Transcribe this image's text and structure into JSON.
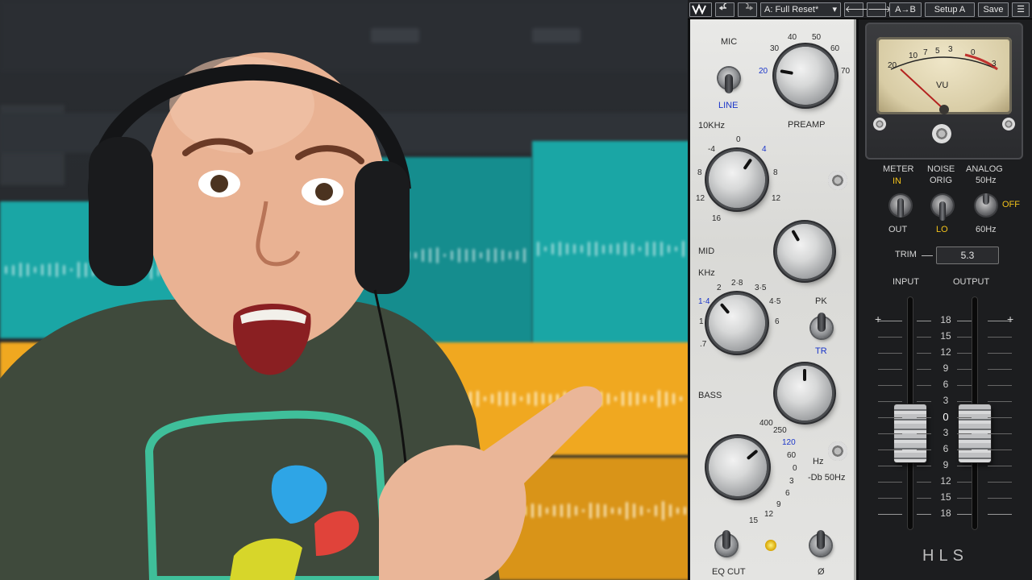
{
  "plugin": {
    "toolbar": {
      "undo_icon": "undo-icon",
      "redo_icon": "redo-icon",
      "preset": "A: Full Reset*",
      "prev_icon": "arrow-left-icon",
      "next_icon": "arrow-right-icon",
      "compare": "A→B",
      "setup": "Setup A",
      "save": "Save",
      "menu_icon": "menu-icon"
    },
    "eq": {
      "mic": "MIC",
      "line": "LINE",
      "preamp": "PREAMP",
      "preamp_scale": [
        "20",
        "30",
        "40",
        "50",
        "60",
        "70"
      ],
      "treble_label": "10KHz",
      "treble_scale": [
        "-4",
        "0",
        "4",
        "8",
        "8",
        "12",
        "12",
        "16"
      ],
      "mid": "MID",
      "khz": "KHz",
      "mid_freq_scale": [
        "1·4",
        "2",
        "2·8",
        "3·5",
        "4·5",
        "6",
        "1",
        ".7"
      ],
      "pk": "PK",
      "tr": "TR",
      "bass": "BASS",
      "bass_scale": [
        "400",
        "250",
        "120",
        "60",
        "0",
        "3",
        "6",
        "9",
        "12",
        "15"
      ],
      "hz": "Hz",
      "db50": "-Db 50Hz",
      "eq_cut": "EQ CUT",
      "phase": "Ø"
    },
    "right": {
      "vu_scale": [
        "20",
        "10",
        "7",
        "5",
        "3",
        "0",
        "3"
      ],
      "vu": "VU",
      "meter": "METER",
      "in": "IN",
      "out": "OUT",
      "noise": "NOISE",
      "orig": "ORIG",
      "lo": "LO",
      "analog": "ANALOG",
      "hz50": "50Hz",
      "hz60": "60Hz",
      "off": "OFF",
      "trim": "TRIM",
      "trim_value": "5.3",
      "input": "INPUT",
      "output": "OUTPUT",
      "fader_scale": [
        "18",
        "15",
        "12",
        "9",
        "6",
        "3",
        "0",
        "3",
        "6",
        "9",
        "12",
        "15",
        "18"
      ],
      "plus": "+",
      "logo": "HLS"
    },
    "colors": {
      "accent_yellow": "#f2c21b",
      "accent_blue": "#1a35c9"
    }
  },
  "daw": {
    "colors": {
      "teal": "#1aa6a5",
      "gold": "#f0a820"
    }
  }
}
